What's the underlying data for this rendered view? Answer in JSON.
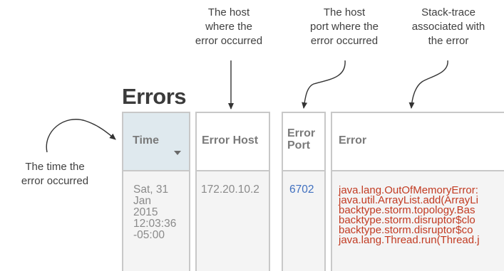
{
  "annotations": {
    "host": [
      "The host",
      "where the",
      "error occurred"
    ],
    "port": [
      "The host",
      "port where the",
      "error occurred"
    ],
    "trace": [
      "Stack-trace",
      "associated with",
      "the error"
    ],
    "time": [
      "The time the",
      "error occurred"
    ]
  },
  "section": {
    "title": "Errors"
  },
  "table": {
    "headers": {
      "time": "Time",
      "host": "Error Host",
      "port_line1": "Error",
      "port_line2": "Port",
      "error": "Error"
    },
    "sorted_column": "time",
    "rows": [
      {
        "time_lines": [
          "Sat, 31",
          "Jan",
          "2015",
          "12:03:36",
          "-05:00"
        ],
        "host": "172.20.10.2",
        "port": "6702",
        "error_lines": [
          "java.lang.OutOfMemoryError:",
          "java.util.ArrayList.add(ArrayLi",
          "backtype.storm.topology.Bas",
          "backtype.storm.disruptor$clo",
          "backtype.storm.disruptor$co",
          "java.lang.Thread.run(Thread.j"
        ]
      }
    ]
  },
  "colors": {
    "sorted_header_bg": "#dfe9ee",
    "port_link": "#3f6fbf",
    "error_text": "#c23b22",
    "row_bg": "#f4f4f4"
  }
}
